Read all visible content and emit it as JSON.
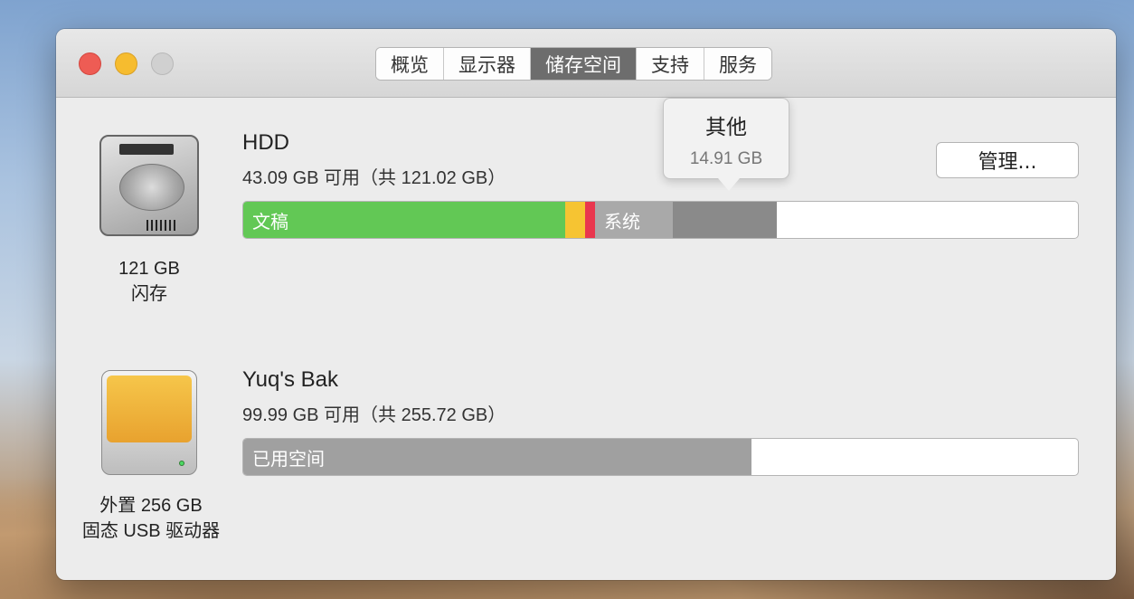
{
  "tabs": [
    {
      "label": "概览",
      "active": false
    },
    {
      "label": "显示器",
      "active": false
    },
    {
      "label": "储存空间",
      "active": true
    },
    {
      "label": "支持",
      "active": false
    },
    {
      "label": "服务",
      "active": false
    }
  ],
  "manage_button": "管理...",
  "tooltip": {
    "title": "其他",
    "size": "14.91 GB"
  },
  "drives": [
    {
      "name": "HDD",
      "free": "43.09 GB 可用（共 121.02 GB）",
      "caption_line1": "121 GB",
      "caption_line2": "闪存",
      "segments": [
        {
          "label": "文稿",
          "fraction": 0.386,
          "color": "#62c855"
        },
        {
          "label": "",
          "fraction": 0.024,
          "color": "#f6c432"
        },
        {
          "label": "",
          "fraction": 0.012,
          "color": "#e9374e"
        },
        {
          "label": "系统",
          "fraction": 0.093,
          "color": "#a9a9a9"
        },
        {
          "label": "",
          "fraction": 0.125,
          "color": "#8a8a8a"
        }
      ]
    },
    {
      "name": "Yuq's Bak",
      "free": "99.99 GB 可用（共 255.72 GB）",
      "caption_line1": "外置 256 GB",
      "caption_line2": "固态 USB 驱动器",
      "segments": [
        {
          "label": "已用空间",
          "fraction": 0.609,
          "color": "#a0a0a0"
        }
      ]
    }
  ],
  "icons": {
    "hdd": "hard-drive-icon",
    "usb": "external-usb-drive-icon"
  }
}
